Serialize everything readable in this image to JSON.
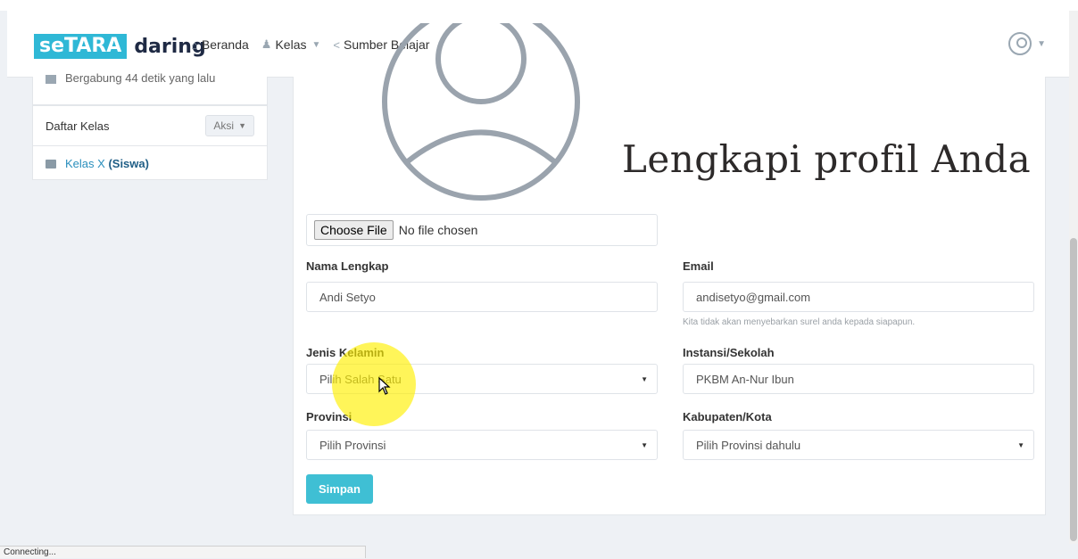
{
  "brand": {
    "part1": "seTARA",
    "part2": "daring"
  },
  "nav": {
    "items": [
      {
        "label": "Beranda",
        "icon": "home-icon"
      },
      {
        "label": "Kelas",
        "icon": "users-icon"
      },
      {
        "label": "Sumber Belajar",
        "icon": "share-icon"
      }
    ]
  },
  "sidebar": {
    "joined_text": "Bergabung 44 detik yang lalu",
    "class_list_title": "Daftar Kelas",
    "action_label": "Aksi",
    "classes": [
      {
        "name": "Kelas X",
        "role": "(Siswa)"
      }
    ]
  },
  "profile": {
    "headline": "Lengkapi profil Anda",
    "file_button": "Choose File",
    "file_status": "No file chosen",
    "name_label": "Nama Lengkap",
    "name_value": "Andi Setyo",
    "email_label": "Email",
    "email_value": "andisetyo@gmail.com",
    "email_help": "Kita tidak akan menyebarkan surel anda kepada siapapun.",
    "gender_label": "Jenis Kelamin",
    "gender_value": "Pilih Salah Satu",
    "school_label": "Instansi/Sekolah",
    "school_value": "PKBM An-Nur Ibun",
    "province_label": "Provinsi",
    "province_value": "Pilih Provinsi",
    "city_label": "Kabupaten/Kota",
    "city_value": "Pilih Provinsi dahulu",
    "save_label": "Simpan"
  },
  "status": {
    "text": "Connecting..."
  },
  "colors": {
    "brand": "#2fb8d6",
    "save_button": "#3fbfd4",
    "link": "#2a8fbd"
  }
}
